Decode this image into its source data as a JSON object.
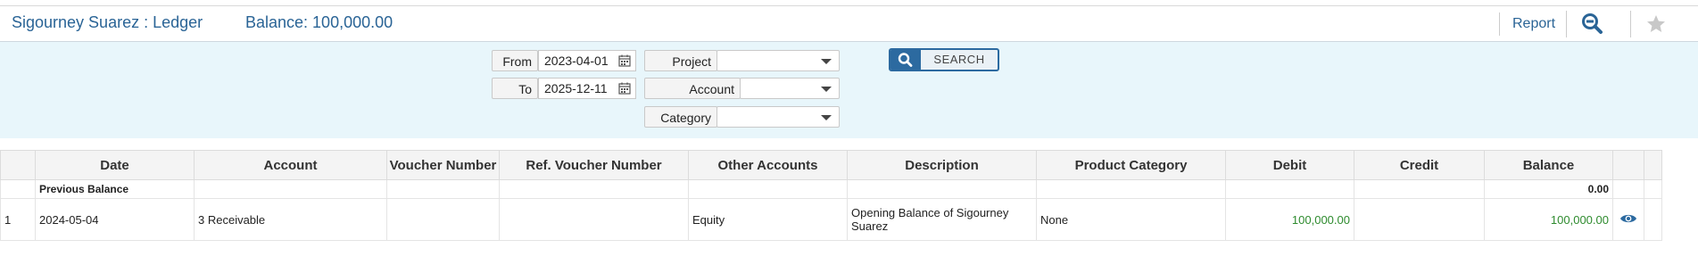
{
  "header": {
    "title": "Sigourney Suarez : Ledger",
    "balance": "Balance: 100,000.00",
    "report_label": "Report"
  },
  "filters": {
    "from_label": "From",
    "from_value": "2023-04-01",
    "to_label": "To",
    "to_value": "2025-12-11",
    "project_label": "Project",
    "project_value": "",
    "account_label": "Account",
    "account_value": "",
    "category_label": "Category",
    "category_value": "",
    "search_label": "SEARCH"
  },
  "table": {
    "columns": [
      "Date",
      "Account",
      "Voucher Number",
      "Ref. Voucher Number",
      "Other Accounts",
      "Description",
      "Product Category",
      "Debit",
      "Credit",
      "Balance"
    ],
    "previous": {
      "label": "Previous Balance",
      "balance": "0.00"
    },
    "rows": [
      {
        "index": "1",
        "date": "2024-05-04",
        "account": "3 Receivable",
        "voucher": "",
        "ref_voucher": "",
        "other_accounts": "Equity",
        "description": "Opening Balance of Sigourney Suarez",
        "product_category": "None",
        "debit": "100,000.00",
        "credit": "",
        "balance": "100,000.00"
      }
    ]
  },
  "colors": {
    "accent": "#2a6496",
    "filter_bg": "#e8f6fb",
    "positive": "#2e8b2e"
  }
}
